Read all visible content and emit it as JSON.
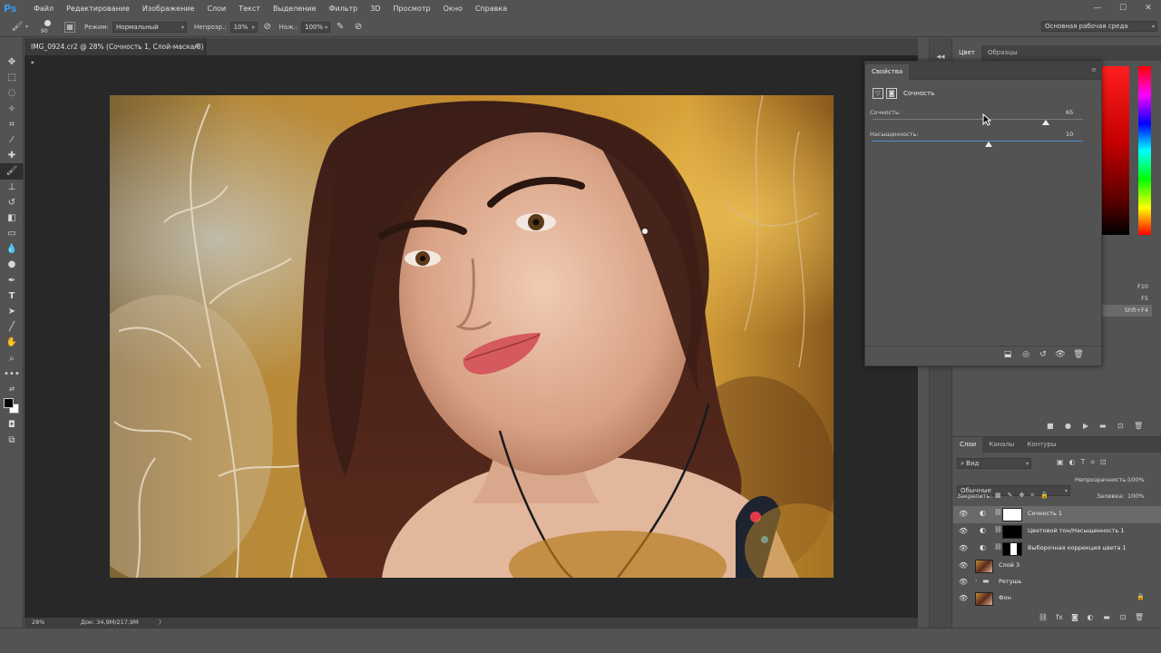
{
  "app": {
    "logo": "Ps"
  },
  "menu": [
    "Файл",
    "Редактирование",
    "Изображение",
    "Слои",
    "Текст",
    "Выделение",
    "Фильтр",
    "3D",
    "Просмотр",
    "Окно",
    "Справка"
  ],
  "window_controls": {
    "minimize": "—",
    "maximize": "☐",
    "close": "✕"
  },
  "options": {
    "brush_size": "90",
    "mode_label": "Режим:",
    "mode_value": "Нормальный",
    "opacity_label": "Непрозр.:",
    "opacity_value": "10%",
    "flow_label": "Наж.:",
    "flow_value": "100%",
    "workspace": "Основная рабочая среда"
  },
  "document": {
    "tab_title": "IMG_0924.cr2 @ 28% (Сочность 1, Слой-маска/8) *",
    "zoom": "28%",
    "doc_info": "Док: 34,9M/217,9M",
    "status_arrow": "〉"
  },
  "color_panel": {
    "tabs": [
      "Цвет",
      "Образцы"
    ]
  },
  "history_shortcuts": [
    "F10",
    "F5",
    "Shft+F4"
  ],
  "properties": {
    "tab": "Свойства",
    "title": "Сочность",
    "vibrance_label": "Сочность:",
    "vibrance_value": "65",
    "vibrance_level": 65,
    "saturation_label": "Насыщенность:",
    "saturation_value": "10",
    "saturation_level": 10
  },
  "layers_panel": {
    "tabs": [
      "Слои",
      "Каналы",
      "Контуры"
    ],
    "filter_label": "Вид",
    "blend_mode": "Обычные",
    "opacity_label": "Непрозрачность:",
    "opacity_value": "100%",
    "lock_label": "Закрепить:",
    "fill_label": "Заливка:",
    "fill_value": "100%",
    "layers": [
      {
        "name": "Сочность 1",
        "type": "adjustment",
        "selected": true,
        "mask": "white"
      },
      {
        "name": "Цветовой тон/Насыщенность 1",
        "type": "adjustment",
        "selected": false,
        "mask": "black"
      },
      {
        "name": "Выборочная коррекция цвета 1",
        "type": "adjustment",
        "selected": false,
        "mask": "silhouette"
      },
      {
        "name": "Слой 3",
        "type": "pixel",
        "selected": false
      },
      {
        "name": "Ретушь",
        "type": "group",
        "selected": false
      },
      {
        "name": "Фон",
        "type": "pixel",
        "selected": false,
        "locked": true
      }
    ]
  },
  "colors": {
    "accent_blue": "#3d9ae8",
    "panel_bg": "#535353",
    "canvas_bg": "#282828",
    "selected_row": "#6a6a6a"
  }
}
